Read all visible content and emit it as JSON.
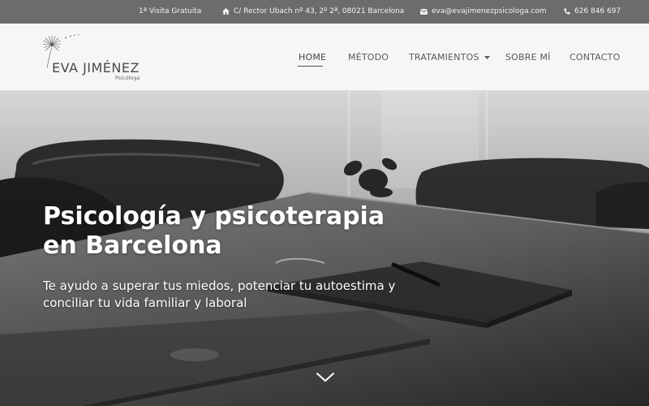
{
  "topbar": {
    "visit": "1ª Visita Gratuita",
    "address": "C/ Rector Ubach nº 43, 2º 2ª, 08021 Barcelona",
    "email": "eva@evajimenezpsicologa.com",
    "phone": "626 846 697"
  },
  "logo": {
    "name": "EVA JIMÉNEZ",
    "subtitle": "Psicóloga"
  },
  "nav": {
    "home": "HOME",
    "metodo": "MÉTODO",
    "tratamientos": "TRATAMIENTOS",
    "sobre": "SOBRE MÍ",
    "contacto": "CONTACTO"
  },
  "hero": {
    "title": "Psicología y psicoterapia en Barcelona",
    "subtitle": "Te ayudo a superar tus miedos, potenciar tu autoestima y conciliar tu vida familiar y laboral"
  },
  "icons": {
    "home": "home-icon",
    "email": "envelope-icon",
    "phone": "phone-icon",
    "dropdown": "caret-down-icon",
    "scroll": "chevron-down-icon",
    "logo": "dandelion-icon"
  }
}
